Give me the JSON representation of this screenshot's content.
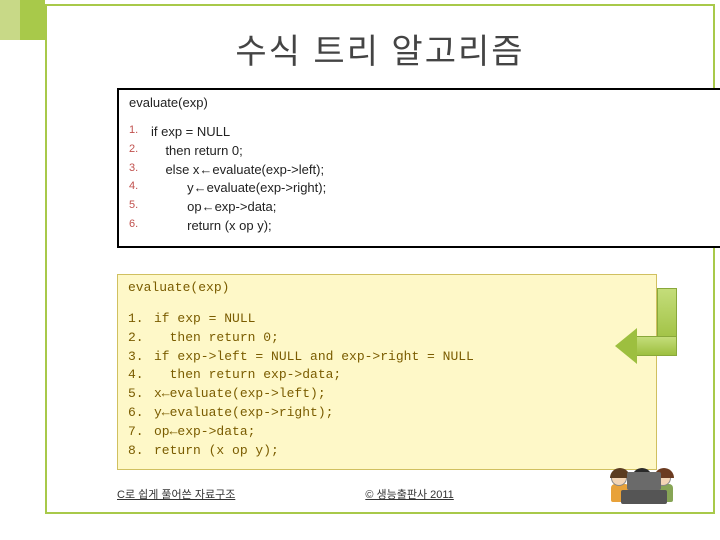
{
  "title": "수식 트리 알고리즘",
  "box1": {
    "header": "evaluate(exp)",
    "lines": [
      {
        "n": "1.",
        "t": "if exp = NULL"
      },
      {
        "n": "2.",
        "t": "    then return 0;"
      },
      {
        "n": "3.",
        "t": "    else x←evaluate(exp->left);"
      },
      {
        "n": "4.",
        "t": "          y←evaluate(exp->right);"
      },
      {
        "n": "5.",
        "t": "          op←exp->data;"
      },
      {
        "n": "6.",
        "t": "          return (x op y);"
      }
    ]
  },
  "box2": {
    "header": "evaluate(exp)",
    "lines": [
      {
        "n": "1.",
        "t": "if exp = NULL"
      },
      {
        "n": "2.",
        "t": "  then return 0;"
      },
      {
        "n": "3.",
        "t": "if exp->left = NULL and exp->right = NULL"
      },
      {
        "n": "4.",
        "t": "  then return exp->data;"
      },
      {
        "n": "5.",
        "t": "x←evaluate(exp->left);"
      },
      {
        "n": "6.",
        "t": "y←evaluate(exp->right);"
      },
      {
        "n": "7.",
        "t": "op←exp->data;"
      },
      {
        "n": "8.",
        "t": "return (x op y);"
      }
    ]
  },
  "footer": {
    "left": "C로 쉽게 풀어쓴 자료구조",
    "right": "© 생능출판사 2011"
  }
}
